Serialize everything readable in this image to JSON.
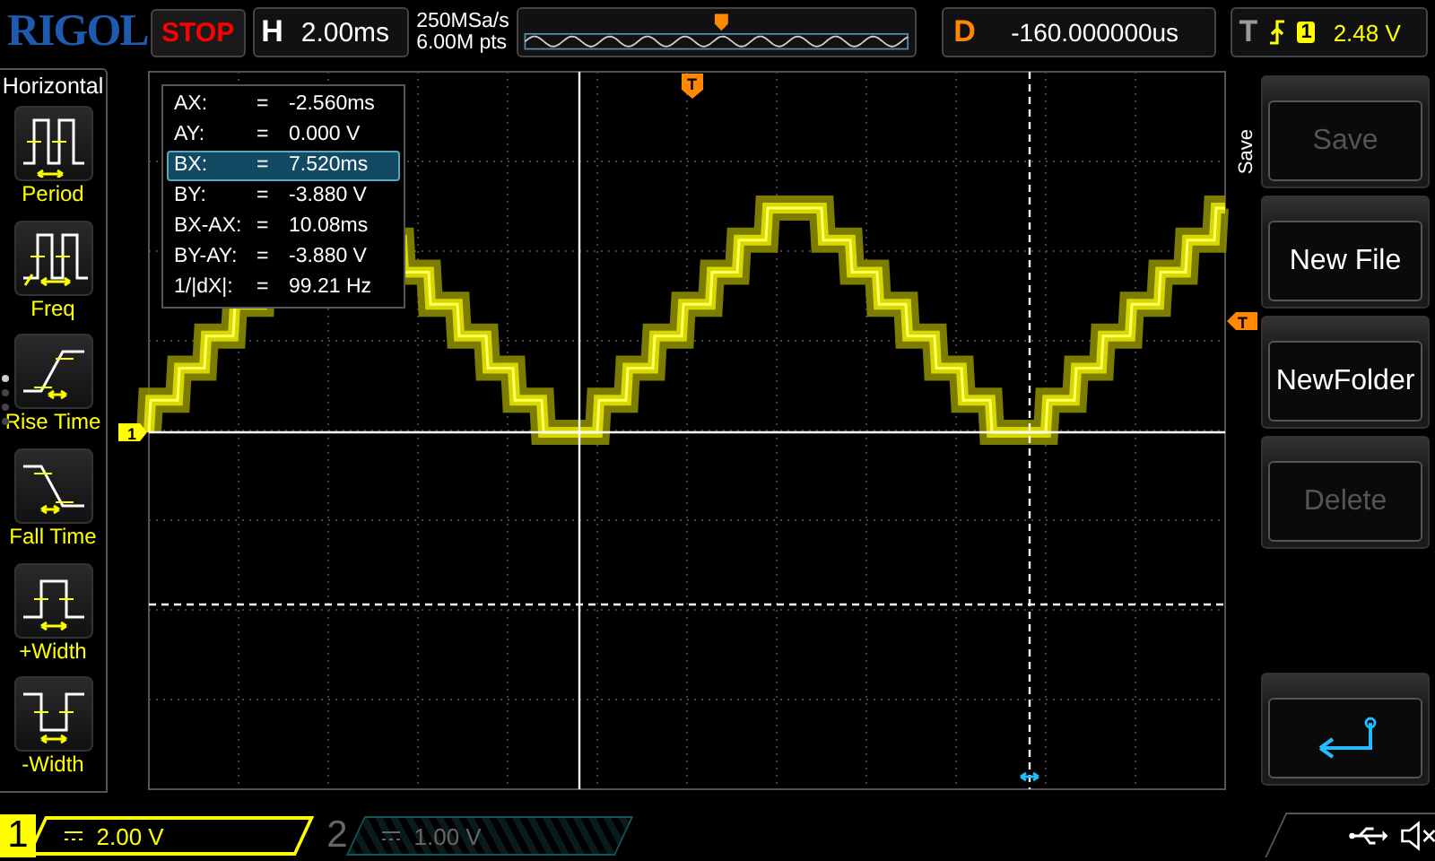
{
  "top_bar": {
    "logo": "RIGOL",
    "run_state": "STOP",
    "timebase": {
      "label": "H",
      "value": "2.00ms"
    },
    "sample_rate": "250MSa/s",
    "memory_depth": "6.00M pts",
    "delay": {
      "label": "D",
      "value": "-160.000000us"
    },
    "trigger": {
      "label": "T",
      "source": "1",
      "level": "2.48 V"
    }
  },
  "measure_panel": {
    "title": "Horizontal",
    "items": [
      {
        "label": "Period",
        "kind": "period"
      },
      {
        "label": "Freq",
        "kind": "freq"
      },
      {
        "label": "Rise Time",
        "kind": "rise"
      },
      {
        "label": "Fall Time",
        "kind": "fall"
      },
      {
        "label": "+Width",
        "kind": "pos-width"
      },
      {
        "label": "-Width",
        "kind": "neg-width"
      }
    ]
  },
  "cursor_readout": {
    "rows": [
      {
        "name": "AX:",
        "eq": "=",
        "value": "-2.560ms",
        "selected": false
      },
      {
        "name": "AY:",
        "eq": "=",
        "value": "0.000 V",
        "selected": false
      },
      {
        "name": "BX:",
        "eq": "=",
        "value": "7.520ms",
        "selected": true
      },
      {
        "name": "BY:",
        "eq": "=",
        "value": "-3.880 V",
        "selected": false
      },
      {
        "name": "BX-AX:",
        "eq": "=",
        "value": "10.08ms",
        "selected": false
      },
      {
        "name": "BY-AY:",
        "eq": "=",
        "value": "-3.880 V",
        "selected": false
      },
      {
        "name": "1/|dX|:",
        "eq": "=",
        "value": "99.21 Hz",
        "selected": false
      }
    ]
  },
  "scope": {
    "channel_marker": "1",
    "trigger_level_marker": "T",
    "trigger_position_marker": "T"
  },
  "side_menu": {
    "title": "Save",
    "buttons": [
      {
        "kind": "text",
        "label": "Save",
        "disabled": true
      },
      {
        "kind": "text",
        "label": "New File",
        "disabled": false
      },
      {
        "kind": "text",
        "label": "NewFolder",
        "disabled": false
      },
      {
        "kind": "text",
        "label": "Delete",
        "disabled": true
      },
      {
        "kind": "back",
        "disabled": false
      }
    ]
  },
  "channels": [
    {
      "number": "1",
      "scale": "2.00 V",
      "active": true
    },
    {
      "number": "2",
      "scale": "1.00 V",
      "active": false
    }
  ]
}
